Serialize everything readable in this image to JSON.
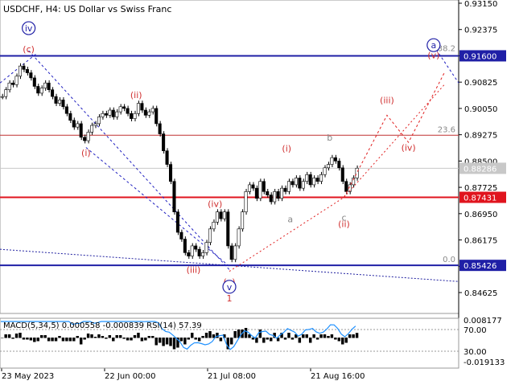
{
  "chart_data": {
    "type": "candlestick",
    "symbol": "USDCHF",
    "timeframe": "H4",
    "description": "US Dollar vs Swiss Franc",
    "price_axis": {
      "ylim": [
        0.84625,
        0.9315
      ],
      "ticks": [
        "0.93150",
        "0.92375",
        "0.91600",
        "0.90825",
        "0.90050",
        "0.89275",
        "0.88500",
        "0.87725",
        "0.86950",
        "0.86175",
        "0.85400",
        "0.84625"
      ]
    },
    "time_axis": {
      "ticks": [
        "23 May 2023",
        "22 Jun 00:00",
        "21 Jul 08:00",
        "21 Aug 16:00"
      ]
    },
    "price_labels": [
      {
        "name": "upper-level",
        "value": "0.91600",
        "color": "#1f1fa6"
      },
      {
        "name": "current-price",
        "value": "0.88286",
        "color": "#c8c8c8"
      },
      {
        "name": "pivot",
        "value": "0.87431",
        "color": "#e0141e"
      },
      {
        "name": "lower-level",
        "value": "0.85426",
        "color": "#1f1fa6"
      }
    ],
    "levels": [
      {
        "name": "horizontal-blue-top",
        "value": 0.916,
        "color": "#1f1fa6"
      },
      {
        "name": "fib-23.6",
        "value": 0.8926,
        "label": "23.6",
        "color": "#c03030"
      },
      {
        "name": "current-price-line",
        "value": 0.88286,
        "color": "#c8c8c8"
      },
      {
        "name": "pivot-red",
        "value": 0.87431,
        "color": "#e0141e"
      },
      {
        "name": "horizontal-blue-bottom",
        "value": 0.85426,
        "label": "0.0",
        "color": "#1f1fa6"
      }
    ],
    "fib_top_label": "38.2",
    "wave_labels": [
      {
        "text": "iv",
        "circled": true,
        "color": "#1f1fa6",
        "t": 8,
        "p": 0.9232
      },
      {
        "text": "(c)",
        "color": "#d03030",
        "t": 8,
        "p": 0.917
      },
      {
        "text": "(i)",
        "color": "#d03030",
        "t": 24,
        "p": 0.8865
      },
      {
        "text": "(ii)",
        "color": "#d03030",
        "t": 38,
        "p": 0.9035
      },
      {
        "text": "(iii)",
        "color": "#d03030",
        "t": 54,
        "p": 0.852
      },
      {
        "text": "(iv)",
        "color": "#d03030",
        "t": 60,
        "p": 0.8715
      },
      {
        "text": "(v)",
        "color": "#d03030",
        "t": 64,
        "p": 0.8485
      },
      {
        "text": "v",
        "circled": true,
        "color": "#1f1fa6",
        "t": 64,
        "p": 0.847
      },
      {
        "text": "1",
        "color": "#d03030",
        "t": 64,
        "p": 0.8437
      },
      {
        "text": "(i)",
        "color": "#d03030",
        "t": 80,
        "p": 0.8878
      },
      {
        "text": "a",
        "color": "#888888",
        "t": 81,
        "p": 0.867
      },
      {
        "text": "b",
        "color": "#888888",
        "t": 92,
        "p": 0.891
      },
      {
        "text": "c",
        "color": "#888888",
        "t": 96,
        "p": 0.8675
      },
      {
        "text": "(ii)",
        "color": "#d03030",
        "t": 96,
        "p": 0.8655
      },
      {
        "text": "(iii)",
        "color": "#d03030",
        "t": 108,
        "p": 0.902
      },
      {
        "text": "(iv)",
        "color": "#d03030",
        "t": 114,
        "p": 0.888
      },
      {
        "text": "a",
        "circled": true,
        "color": "#1f1fa6",
        "t": 121,
        "p": 0.9182
      },
      {
        "text": "(v)",
        "color": "#d03030",
        "t": 121,
        "p": 0.9153
      }
    ],
    "candles_close": [
      0.904,
      0.906,
      0.908,
      0.9075,
      0.91,
      0.913,
      0.912,
      0.911,
      0.9095,
      0.907,
      0.905,
      0.9065,
      0.908,
      0.906,
      0.904,
      0.902,
      0.903,
      0.901,
      0.899,
      0.897,
      0.895,
      0.896,
      0.892,
      0.891,
      0.8935,
      0.8955,
      0.896,
      0.898,
      0.899,
      0.8985,
      0.9,
      0.898,
      0.8995,
      0.901,
      0.9005,
      0.899,
      0.8975,
      0.899,
      0.902,
      0.9,
      0.8985,
      0.8995,
      0.9005,
      0.896,
      0.893,
      0.888,
      0.884,
      0.879,
      0.87,
      0.864,
      0.862,
      0.858,
      0.857,
      0.86,
      0.859,
      0.857,
      0.858,
      0.861,
      0.865,
      0.867,
      0.87,
      0.868,
      0.87,
      0.86,
      0.856,
      0.86,
      0.865,
      0.87,
      0.876,
      0.878,
      0.877,
      0.874,
      0.879,
      0.876,
      0.875,
      0.873,
      0.876,
      0.874,
      0.877,
      0.876,
      0.879,
      0.878,
      0.88,
      0.877,
      0.879,
      0.881,
      0.878,
      0.88,
      0.879,
      0.881,
      0.883,
      0.884,
      0.886,
      0.885,
      0.883,
      0.879,
      0.876,
      0.878,
      0.88,
      0.8829
    ],
    "projection_path": [
      [
        96,
        0.8743
      ],
      [
        108,
        0.8985
      ],
      [
        114,
        0.8905
      ],
      [
        124,
        0.911
      ]
    ],
    "projection_path_alt": [
      [
        96,
        0.8743
      ],
      [
        124,
        0.9075
      ]
    ],
    "indicator": {
      "label": "MACD(5,34,5) 0.000558 -0.000839 RSI(14) 57.39",
      "right_ticks": [
        "0.008177",
        "70.00",
        "30.00",
        "-0.019133"
      ]
    }
  }
}
